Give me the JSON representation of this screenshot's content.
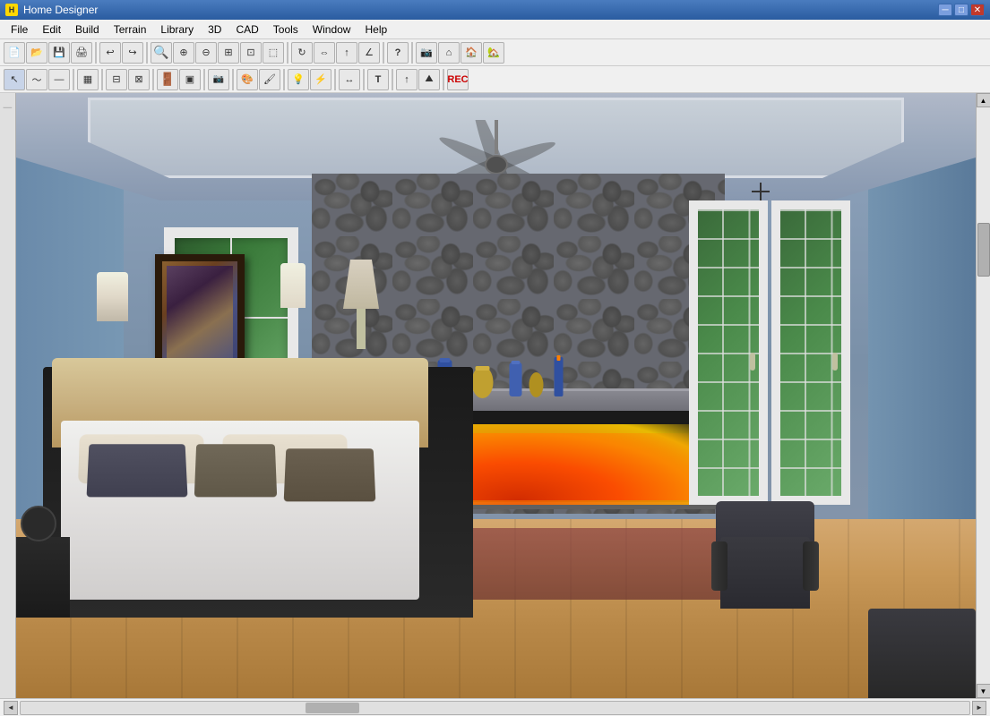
{
  "window": {
    "title": "Home Designer",
    "icon": "H"
  },
  "menubar": {
    "items": [
      "File",
      "Edit",
      "Build",
      "Terrain",
      "Library",
      "3D",
      "CAD",
      "Tools",
      "Window",
      "Help"
    ]
  },
  "toolbar1": {
    "buttons": [
      {
        "name": "new",
        "icon": "📄"
      },
      {
        "name": "open",
        "icon": "📂"
      },
      {
        "name": "save",
        "icon": "💾"
      },
      {
        "name": "print",
        "icon": "🖨"
      },
      {
        "name": "undo",
        "icon": "↩"
      },
      {
        "name": "redo",
        "icon": "↪"
      },
      {
        "name": "zoom-in-area",
        "icon": "🔍"
      },
      {
        "name": "zoom-in",
        "icon": "⊕"
      },
      {
        "name": "zoom-out",
        "icon": "⊖"
      },
      {
        "name": "fit-window",
        "icon": "⊞"
      },
      {
        "name": "extend",
        "icon": "⊡"
      },
      {
        "name": "select-all",
        "icon": "⬚"
      },
      {
        "name": "rotate",
        "icon": "↻"
      },
      {
        "name": "mirror",
        "icon": "⇔"
      },
      {
        "name": "arrow-up",
        "icon": "↑"
      },
      {
        "name": "angle",
        "icon": "∠"
      },
      {
        "name": "question",
        "icon": "?"
      },
      {
        "name": "camera",
        "icon": "📷"
      },
      {
        "name": "house1",
        "icon": "🏠"
      },
      {
        "name": "house2",
        "icon": "🏡"
      },
      {
        "name": "house3",
        "icon": "⌂"
      }
    ]
  },
  "toolbar2": {
    "buttons": [
      {
        "name": "pointer",
        "icon": "↖"
      },
      {
        "name": "polyline",
        "icon": "∿"
      },
      {
        "name": "line",
        "icon": "—"
      },
      {
        "name": "room",
        "icon": "▦"
      },
      {
        "name": "cabinet",
        "icon": "⊟"
      },
      {
        "name": "appliance",
        "icon": "⊠"
      },
      {
        "name": "door",
        "icon": "⊡"
      },
      {
        "name": "window",
        "icon": "▣"
      },
      {
        "name": "camera-3d",
        "icon": "📷"
      },
      {
        "name": "materials",
        "icon": "🎨"
      },
      {
        "name": "electrical",
        "icon": "⚡"
      },
      {
        "name": "lights",
        "icon": "💡"
      },
      {
        "name": "dimensions",
        "icon": "↔"
      },
      {
        "name": "text",
        "icon": "T"
      },
      {
        "name": "up-arrow",
        "icon": "↑"
      },
      {
        "name": "terrain",
        "icon": "⛰"
      },
      {
        "name": "rec",
        "icon": "⏺"
      }
    ]
  },
  "statusbar": {
    "text": ""
  },
  "view": {
    "type": "3D Room View",
    "scene": "Master Bedroom with fireplace, bed, and French doors"
  }
}
